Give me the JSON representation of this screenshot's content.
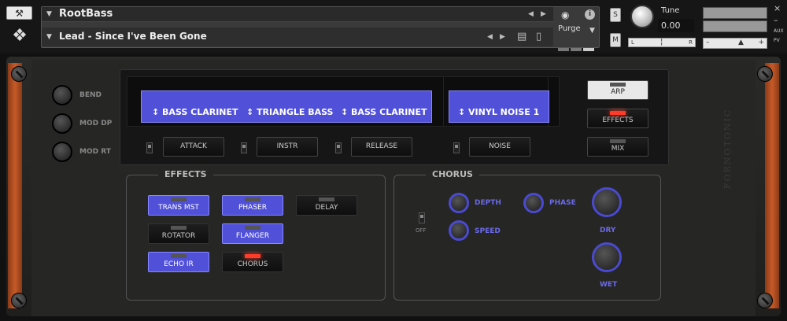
{
  "header": {
    "instrument_title": "RootBass",
    "preset_title": "Lead - Since I've Been Gone",
    "purge_label": "Purge",
    "tune_label": "Tune",
    "tune_value": "0.00",
    "solo_label": "S",
    "mute_label": "M",
    "pan_left": "L",
    "pan_right": "R",
    "pan_center": "¦",
    "vol_minus": "–",
    "vol_plus": "+",
    "close_label": "×",
    "min_label": "–",
    "aux_label": "AUX",
    "pv_label": "PV"
  },
  "left_knobs": [
    {
      "label": "BEND"
    },
    {
      "label": "MOD DP"
    },
    {
      "label": "MOD RT"
    }
  ],
  "display": {
    "slot1": "↕ BASS CLARINET",
    "slot2": "↕ TRIANGLE BASS",
    "slot3": "↕ BASS CLARINET",
    "slot4": "↕ VINYL NOISE 1",
    "attack": "ATTACK",
    "instr": "INSTR",
    "release": "RELEASE",
    "noise": "NOISE"
  },
  "right_buttons": {
    "arp": "ARP",
    "effects": "EFFECTS",
    "mix": "MIX"
  },
  "effects": {
    "title": "EFFECTS",
    "trans_mst": "TRANS MST",
    "phaser": "PHASER",
    "delay": "DELAY",
    "rotator": "ROTATOR",
    "flanger": "FLANGER",
    "echo_ir": "ECHO IR",
    "chorus": "CHORUS"
  },
  "chorus": {
    "title": "CHORUS",
    "off_label": "OFF",
    "depth": "DEPTH",
    "speed": "SPEED",
    "phase": "PHASE",
    "dry": "DRY",
    "wet": "WET"
  },
  "brand": "FORNOTONIC",
  "colors": {
    "accent_blue": "#5050d8",
    "led_red": "#ff3c2a",
    "wood": "#c75a28"
  }
}
